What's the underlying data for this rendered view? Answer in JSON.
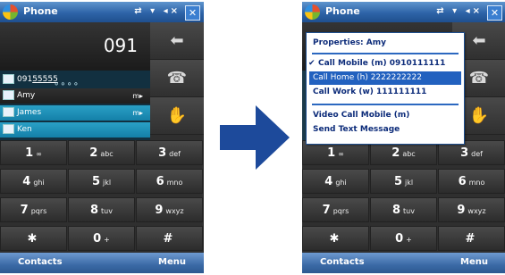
{
  "left_phone": {
    "title": "Phone",
    "status_icons": "⇄ ▾ ◂× ",
    "close": "✕",
    "number": "091",
    "suggestions": [
      {
        "text": "091",
        "highlight": "55555",
        "mark": ""
      },
      {
        "text": "Amy",
        "mark": "m▸"
      },
      {
        "text": "James",
        "mark": "m▸"
      },
      {
        "text": "Ken",
        "mark": ""
      }
    ],
    "side_buttons": [
      "⬅",
      "☎",
      "✋"
    ],
    "keys": [
      {
        "digit": "1",
        "sub": "∞"
      },
      {
        "digit": "2",
        "sub": "abc"
      },
      {
        "digit": "3",
        "sub": "def"
      },
      {
        "digit": "4",
        "sub": "ghi"
      },
      {
        "digit": "5",
        "sub": "jkl"
      },
      {
        "digit": "6",
        "sub": "mno"
      },
      {
        "digit": "7",
        "sub": "pqrs"
      },
      {
        "digit": "8",
        "sub": "tuv"
      },
      {
        "digit": "9",
        "sub": "wxyz"
      },
      {
        "digit": "✱",
        "sub": ""
      },
      {
        "digit": "0",
        "sub": "+"
      },
      {
        "digit": "#",
        "sub": ""
      }
    ],
    "soft_left": "Contacts",
    "soft_right": "Menu"
  },
  "right_phone": {
    "title": "Phone",
    "status_icons": "⇄ ▾ ◂× ",
    "close": "✕",
    "menu": {
      "properties": "Properties: Amy",
      "call_mobile": "Call Mobile (m) 0910111111",
      "call_home": "Call Home (h) 2222222222",
      "call_work": "Call Work (w) 111111111",
      "video_call": "Video Call Mobile (m)",
      "send_text": "Send Text Message",
      "check": "✔"
    },
    "side_buttons": [
      "⬅",
      "☎",
      "✋"
    ],
    "soft_left": "Contacts",
    "soft_right": "Menu"
  },
  "colors": {
    "arrow": "#1d4a9b",
    "titlebar": "#2d63a7",
    "highlight": "#2261bf"
  }
}
